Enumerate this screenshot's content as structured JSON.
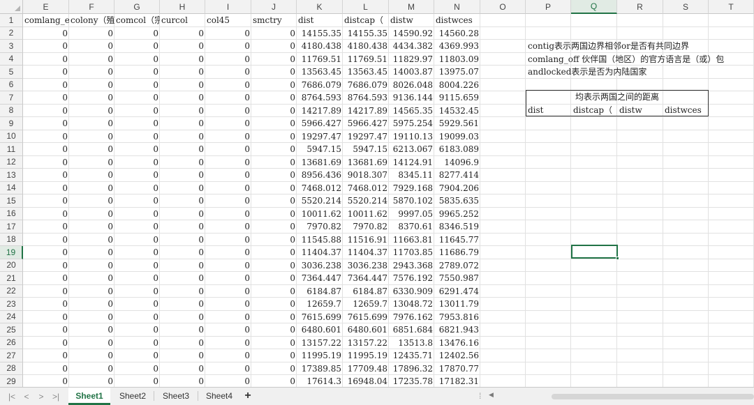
{
  "columns": [
    "E",
    "F",
    "G",
    "H",
    "I",
    "J",
    "K",
    "L",
    "M",
    "N",
    "O",
    "P",
    "Q",
    "R",
    "S",
    "T"
  ],
  "selected_column": "Q",
  "selected_row": 19,
  "header_row": [
    "comlang_e",
    "colony（殖",
    "comcol（宗",
    "curcol",
    "col45",
    "smctry",
    "dist",
    "distcap（",
    "distw",
    "distwces"
  ],
  "rows": [
    {
      "n": 2,
      "k": "14155.35",
      "l": "14155.35",
      "m": "14590.92",
      "nn": "14560.28"
    },
    {
      "n": 3,
      "k": "4180.438",
      "l": "4180.438",
      "m": "4434.382",
      "nn": "4369.993"
    },
    {
      "n": 4,
      "k": "11769.51",
      "l": "11769.51",
      "m": "11829.97",
      "nn": "11803.09"
    },
    {
      "n": 5,
      "k": "13563.45",
      "l": "13563.45",
      "m": "14003.87",
      "nn": "13975.07"
    },
    {
      "n": 6,
      "k": "7686.079",
      "l": "7686.079",
      "m": "8026.048",
      "nn": "8004.226"
    },
    {
      "n": 7,
      "k": "8764.593",
      "l": "8764.593",
      "m": "9136.144",
      "nn": "9115.659"
    },
    {
      "n": 8,
      "k": "14217.89",
      "l": "14217.89",
      "m": "14565.35",
      "nn": "14532.45"
    },
    {
      "n": 9,
      "k": "5966.427",
      "l": "5966.427",
      "m": "5975.254",
      "nn": "5929.561"
    },
    {
      "n": 10,
      "k": "19297.47",
      "l": "19297.47",
      "m": "19110.13",
      "nn": "19099.03"
    },
    {
      "n": 11,
      "k": "5947.15",
      "l": "5947.15",
      "m": "6213.067",
      "nn": "6183.089"
    },
    {
      "n": 12,
      "k": "13681.69",
      "l": "13681.69",
      "m": "14124.91",
      "nn": "14096.9"
    },
    {
      "n": 13,
      "k": "8956.436",
      "l": "9018.307",
      "m": "8345.11",
      "nn": "8277.414"
    },
    {
      "n": 14,
      "k": "7468.012",
      "l": "7468.012",
      "m": "7929.168",
      "nn": "7904.206"
    },
    {
      "n": 15,
      "k": "5520.214",
      "l": "5520.214",
      "m": "5870.102",
      "nn": "5835.635"
    },
    {
      "n": 16,
      "k": "10011.62",
      "l": "10011.62",
      "m": "9997.05",
      "nn": "9965.252"
    },
    {
      "n": 17,
      "k": "7970.82",
      "l": "7970.82",
      "m": "8370.61",
      "nn": "8346.519"
    },
    {
      "n": 18,
      "k": "11545.88",
      "l": "11516.91",
      "m": "11663.81",
      "nn": "11645.77"
    },
    {
      "n": 19,
      "k": "11404.37",
      "l": "11404.37",
      "m": "11703.85",
      "nn": "11686.79"
    },
    {
      "n": 20,
      "k": "3036.238",
      "l": "3036.238",
      "m": "2943.368",
      "nn": "2789.072"
    },
    {
      "n": 21,
      "k": "7364.447",
      "l": "7364.447",
      "m": "7576.192",
      "nn": "7550.987"
    },
    {
      "n": 22,
      "k": "6184.87",
      "l": "6184.87",
      "m": "6330.909",
      "nn": "6291.474"
    },
    {
      "n": 23,
      "k": "12659.7",
      "l": "12659.7",
      "m": "13048.72",
      "nn": "13011.79"
    },
    {
      "n": 24,
      "k": "7615.699",
      "l": "7615.699",
      "m": "7976.162",
      "nn": "7953.816"
    },
    {
      "n": 25,
      "k": "6480.601",
      "l": "6480.601",
      "m": "6851.684",
      "nn": "6821.943"
    },
    {
      "n": 26,
      "k": "13157.22",
      "l": "13157.22",
      "m": "13513.8",
      "nn": "13476.16"
    },
    {
      "n": 27,
      "k": "11995.19",
      "l": "11995.19",
      "m": "12435.71",
      "nn": "12402.56"
    },
    {
      "n": 28,
      "k": "17389.85",
      "l": "17709.48",
      "m": "17896.32",
      "nn": "17870.77"
    },
    {
      "n": 29,
      "k": "17614.3",
      "l": "16948.04",
      "m": "17235.78",
      "nn": "17182.31"
    }
  ],
  "zero_value": "0",
  "notes": [
    "contig表示两国边界相邻or是否有共同边界",
    "comlang_off  伙伴国（地区）的官方语言是（或）包",
    "andlocked表示是否为内陆国家"
  ],
  "distance_box": {
    "title": "均表示两国之间的距离",
    "headers": [
      "dist",
      "distcap（",
      "distw",
      "distwces"
    ]
  },
  "sheet_tabs": [
    "Sheet1",
    "Sheet2",
    "Sheet3",
    "Sheet4"
  ],
  "active_sheet": "Sheet1",
  "nav_icons": [
    "first-sheet-icon",
    "prev-sheet-icon",
    "next-sheet-icon",
    "last-sheet-icon"
  ],
  "add_sheet_label": "+",
  "accent_color": "#217346"
}
